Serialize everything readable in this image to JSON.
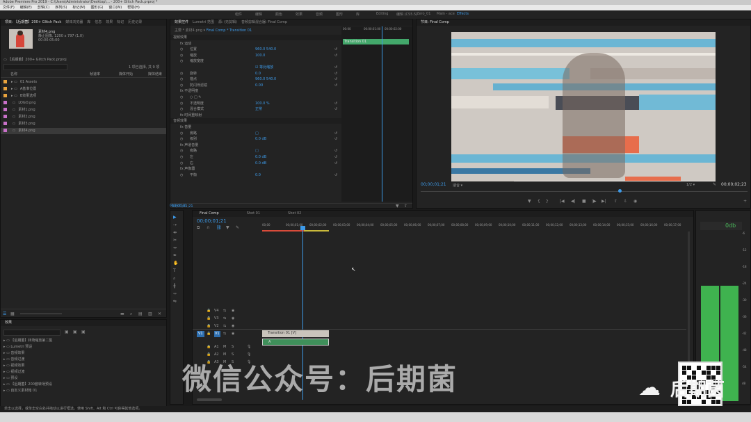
{
  "window": {
    "title": "Adobe Premiere Pro 2019 - C:\\Users\\Administrator\\Desktop\\... - 200+ Glitch Pack.prproj *"
  },
  "menu": [
    "文件(F)",
    "编辑(E)",
    "剪辑(C)",
    "序列(S)",
    "标记(M)",
    "图形(G)",
    "窗口(W)",
    "帮助(H)"
  ],
  "workspaces": [
    "组件",
    "编辑",
    "颜色",
    "效果",
    "音频",
    "图形",
    "库",
    "Editing",
    "编辑 (CS5.5)",
    "Zero_01",
    "Main - ace",
    "Effects"
  ],
  "project": {
    "tabs": [
      "项目: 【后期菌】200+ Glitch Pack",
      "媒体浏览器",
      "库",
      "信息",
      "效果",
      "标记",
      "历史记录"
    ],
    "preview_name": "素材4.png",
    "preview_type": "静止图像, 1200 x 797 (1.0)",
    "preview_duration": "00:00:05:00",
    "bin_path": "【后期菌】200+ Glitch Pack.prproj",
    "item_count": "1 项已选择, 共 9 项",
    "columns": [
      "名称",
      "帧速率",
      "媒体开始",
      "媒体结束"
    ],
    "items": [
      {
        "name": "01 Assets",
        "color": "#e8a33d"
      },
      {
        "name": "A基准位置",
        "color": "#e8a33d"
      },
      {
        "name": "B效果选项",
        "color": "#e8a33d"
      },
      {
        "name": "LOGO.png",
        "color": "#c970c9"
      },
      {
        "name": "素材1.png",
        "color": "#c970c9"
      },
      {
        "name": "素材2.png",
        "color": "#c970c9"
      },
      {
        "name": "素材3.png",
        "color": "#c970c9"
      },
      {
        "name": "素材4.png",
        "color": "#c970c9"
      }
    ]
  },
  "effects": {
    "tabs": [
      "效果控件",
      "Lumetri 范围",
      "源: (无剪辑)",
      "音频剪辑混合器: Final Comp"
    ],
    "clip_path": "Final Comp * Transition 01",
    "sections": [
      {
        "label": "视频效果",
        "indent": 0
      },
      {
        "label": "fx 运动",
        "indent": 1
      },
      {
        "label": "位置",
        "indent": 2,
        "value": "960.0    540.0"
      },
      {
        "label": "缩放",
        "indent": 2,
        "value": "100.0"
      },
      {
        "label": "缩放宽度",
        "indent": 2,
        "value": ""
      },
      {
        "label": "",
        "indent": 2,
        "value": "☑ 等比缩放"
      },
      {
        "label": "旋转",
        "indent": 2,
        "value": "0.0"
      },
      {
        "label": "锚点",
        "indent": 2,
        "value": "960.0    540.0"
      },
      {
        "label": "防闪烁滤镜",
        "indent": 2,
        "value": "0.00"
      },
      {
        "label": "fx 不透明度",
        "indent": 1
      },
      {
        "label": "○ □ ✎",
        "indent": 2
      },
      {
        "label": "不透明度",
        "indent": 2,
        "value": "100.0 %"
      },
      {
        "label": "混合模式",
        "indent": 2,
        "value": "正常"
      },
      {
        "label": "fx 时间重映射",
        "indent": 1
      },
      {
        "label": "音频效果",
        "indent": 0
      },
      {
        "label": "fx 音量",
        "indent": 1
      },
      {
        "label": "旁路",
        "indent": 2,
        "value": "□"
      },
      {
        "label": "级别",
        "indent": 2,
        "value": "0.0 dB"
      },
      {
        "label": "fx 声道音量",
        "indent": 1
      },
      {
        "label": "旁路",
        "indent": 2,
        "value": "□"
      },
      {
        "label": "左",
        "indent": 2,
        "value": "0.0 dB"
      },
      {
        "label": "右",
        "indent": 2,
        "value": "0.0 dB"
      },
      {
        "label": "fx 声像器",
        "indent": 1
      },
      {
        "label": "平衡",
        "indent": 2,
        "value": "0.0"
      }
    ],
    "mini_ruler": [
      "00:00",
      "00:00:01:00",
      "00:00:02:00"
    ],
    "mini_clip": "Transition 01",
    "timecode": "00;00;01;21"
  },
  "program": {
    "tab": "节目: Final Comp",
    "timecode": "00;00;01;21",
    "fit": "适合",
    "quality": "1/2",
    "duration": "00;00;02;23"
  },
  "effects_browser": {
    "tab": "效果",
    "items": [
      "【后期菌】转场缩放第二集",
      "Lumetri 预设",
      "音频效果",
      "音频过渡",
      "视频效果",
      "视频过渡",
      "预设",
      "【后期菌】200套转场预设",
      "自定义素材箱 01"
    ]
  },
  "timeline": {
    "tabs": [
      "Final Comp",
      "Shot 01",
      "Shot 02"
    ],
    "timecode": "00;00;01;21",
    "ruler": [
      "00;00",
      "00;00;01;00",
      "00;00;02;00",
      "00;00;03;00",
      "00;00;04;00",
      "00;00;05;00",
      "00;00;06;00",
      "00;00;07;00",
      "00;00;08;00",
      "00;00;09;00",
      "00;00;10;00",
      "00;00;11;00",
      "00;00;12;00",
      "00;00;13;00",
      "00;00;14;00",
      "00;00;15;00",
      "00;00;16;00",
      "00;00;17;00"
    ],
    "video_tracks": [
      "V4",
      "V3",
      "V2",
      "V1"
    ],
    "audio_tracks": [
      "A1",
      "A2",
      "A3"
    ],
    "source_patch_v": "V1",
    "clip_v": "Transition 01 [V]",
    "clip_a": "A"
  },
  "meter": {
    "readout": "0db",
    "scale": [
      "-6",
      "-12",
      "-18",
      "-24",
      "-30",
      "-36",
      "-42",
      "-48",
      "-54",
      "dB"
    ]
  },
  "status": {
    "text": "单击以选择，或单击空白处并拖动以进行框选。使用 Shift、Alt 和 Ctrl 可获得其他选项。"
  },
  "watermark": {
    "text": "微信公众号：后期菌",
    "logo": "后期菌"
  }
}
